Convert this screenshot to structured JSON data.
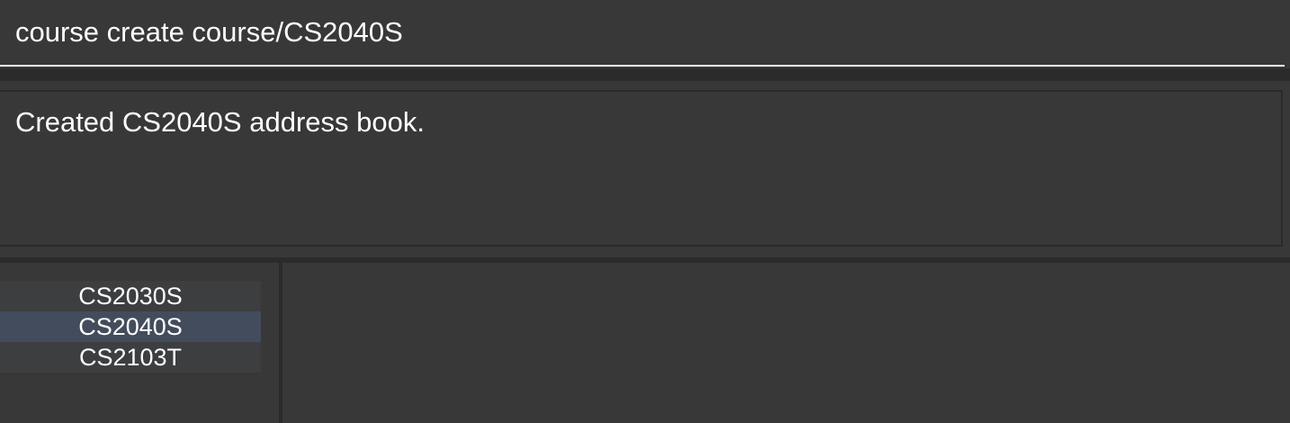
{
  "command": {
    "value": "course create course/CS2040S"
  },
  "result": {
    "message": "Created CS2040S address book."
  },
  "courses": {
    "selected": "CS2040S",
    "items": [
      {
        "label": "CS2030S"
      },
      {
        "label": "CS2040S"
      },
      {
        "label": "CS2103T"
      }
    ]
  },
  "colors": {
    "background": "#383838",
    "selected_item": "#434c5c",
    "item": "#3c3e40",
    "text": "#ffffff"
  }
}
